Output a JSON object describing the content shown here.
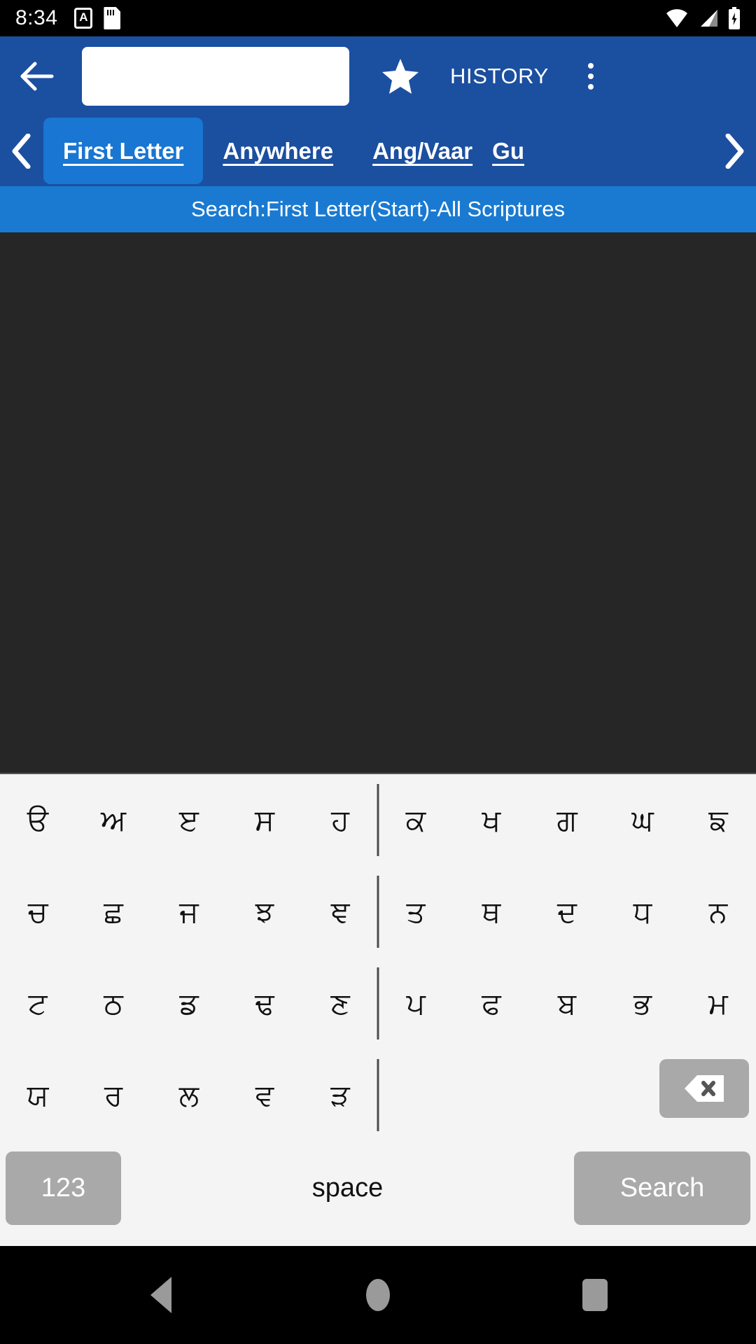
{
  "statusbar": {
    "time": "8:34",
    "left_icons": [
      "letter-a-badge-icon",
      "sd-card-icon"
    ],
    "right_icons": [
      "wifi-icon",
      "cell-signal-icon",
      "battery-charging-icon"
    ]
  },
  "toolbar": {
    "back_icon": "back-arrow-icon",
    "search_value": "",
    "search_placeholder": "",
    "star_icon": "star-icon",
    "history_label": "HISTORY",
    "overflow_icon": "more-vertical-icon"
  },
  "tabs": {
    "left_chevron": "chevron-left-icon",
    "right_chevron": "chevron-right-icon",
    "items": [
      {
        "label": "First Letter",
        "selected": true
      },
      {
        "label": "Anywhere",
        "selected": false
      },
      {
        "label": "Ang/Vaar",
        "selected": false
      },
      {
        "label": "Gu",
        "selected": false
      }
    ]
  },
  "subheader": {
    "text": "Search:First Letter(Start)-All Scriptures"
  },
  "keyboard": {
    "rows": [
      {
        "left": [
          "ੳ",
          "ਅ",
          "ੲ",
          "ਸ",
          "ਹ"
        ],
        "right": [
          "ਕ",
          "ਖ",
          "ਗ",
          "ਘ",
          "ਙ"
        ]
      },
      {
        "left": [
          "ਚ",
          "ਛ",
          "ਜ",
          "ਝ",
          "ਞ"
        ],
        "right": [
          "ਤ",
          "ਥ",
          "ਦ",
          "ਧ",
          "ਨ"
        ]
      },
      {
        "left": [
          "ਟ",
          "ਠ",
          "ਡ",
          "ਢ",
          "ਣ"
        ],
        "right": [
          "ਪ",
          "ਫ",
          "ਬ",
          "ਭ",
          "ਮ"
        ]
      },
      {
        "left": [
          "ਯ",
          "ਰ",
          "ਲ",
          "ਵ",
          "ੜ"
        ],
        "right": [
          "",
          "",
          "",
          "",
          ""
        ]
      }
    ],
    "backspace_icon": "backspace-icon",
    "numeric_label": "123",
    "space_label": "space",
    "search_label": "Search"
  },
  "navbar": {
    "back_icon": "nav-back-icon",
    "home_icon": "nav-home-icon",
    "recents_icon": "nav-recents-icon"
  },
  "colors": {
    "toolbar_blue": "#1b4fa0",
    "tab_selected_blue": "#1976d2",
    "subheader_blue": "#1a7ad1",
    "content_dark": "#262626",
    "keyboard_bg": "#f4f4f4",
    "key_gray": "#a9a9a9"
  }
}
